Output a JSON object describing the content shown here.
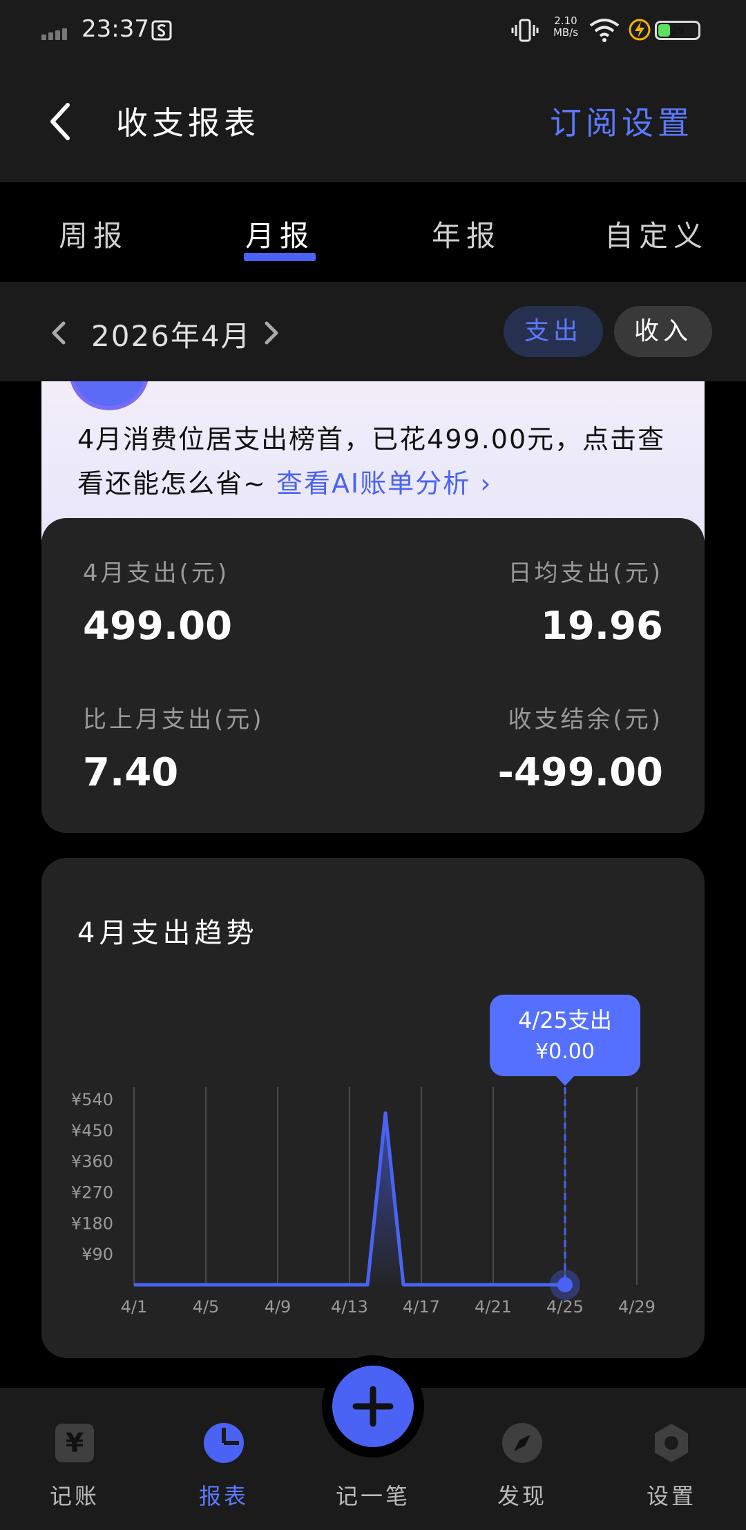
{
  "status_bar": {
    "time": "23:37",
    "net_speed_value": "2.10",
    "net_speed_unit": "MB/s",
    "battery": "29"
  },
  "header": {
    "title": "收支报表",
    "subscribe_label": "订阅设置"
  },
  "tabs": [
    {
      "label": "周报"
    },
    {
      "label": "月报",
      "active": true
    },
    {
      "label": "年报"
    },
    {
      "label": "自定义"
    }
  ],
  "period": {
    "label": "2026年4月",
    "expense_label": "支出",
    "income_label": "收入",
    "active": "支出"
  },
  "ai_banner": {
    "message": "4月消费位居支出榜首，已花499.00元，点击查看还能怎么省~",
    "link_label": "查看AI账单分析"
  },
  "summary": {
    "month_expense_label": "4月支出(元)",
    "month_expense_value": "499.00",
    "daily_avg_label": "日均支出(元)",
    "daily_avg_value": "19.96",
    "vs_last_month_label": "比上月支出(元)",
    "vs_last_month_value": "7.40",
    "balance_label": "收支结余(元)",
    "balance_value": "-499.00"
  },
  "trend": {
    "title": "4月支出趋势",
    "tooltip_line1": "4/25支出",
    "tooltip_line2": "¥0.00"
  },
  "chart_data": {
    "type": "area",
    "ylim": [
      0,
      560
    ],
    "y_ticks": [
      90,
      180,
      270,
      360,
      450,
      540
    ],
    "y_tick_labels": [
      "¥90",
      "¥180",
      "¥270",
      "¥360",
      "¥450",
      "¥540"
    ],
    "x_ticks": [
      1,
      5,
      9,
      13,
      17,
      21,
      25,
      29
    ],
    "x_tick_labels": [
      "4/1",
      "4/5",
      "4/9",
      "4/13",
      "4/17",
      "4/21",
      "4/25",
      "4/29"
    ],
    "x": [
      1,
      2,
      3,
      4,
      5,
      6,
      7,
      8,
      9,
      10,
      11,
      12,
      13,
      14,
      15,
      16,
      17,
      18,
      19,
      20,
      21,
      22,
      23,
      24,
      25
    ],
    "values": [
      0,
      0,
      0,
      0,
      0,
      0,
      0,
      0,
      0,
      0,
      0,
      0,
      0,
      0,
      499,
      0,
      0,
      0,
      0,
      0,
      0,
      0,
      0,
      0,
      0
    ],
    "highlight_x": 25,
    "grid": "vertical",
    "color": "#4a63f5"
  },
  "colors": {
    "accent": "#4a63f5",
    "link": "#5b79ff",
    "card": "#232323",
    "background": "#000000"
  },
  "bottom_nav": [
    {
      "label": "记账",
      "icon": "yen-icon"
    },
    {
      "label": "报表",
      "icon": "pie-chart-icon",
      "active": true
    },
    {
      "label": "记一笔",
      "icon": "plus-icon"
    },
    {
      "label": "发现",
      "icon": "compass-icon"
    },
    {
      "label": "设置",
      "icon": "hexagon-gear-icon"
    }
  ]
}
